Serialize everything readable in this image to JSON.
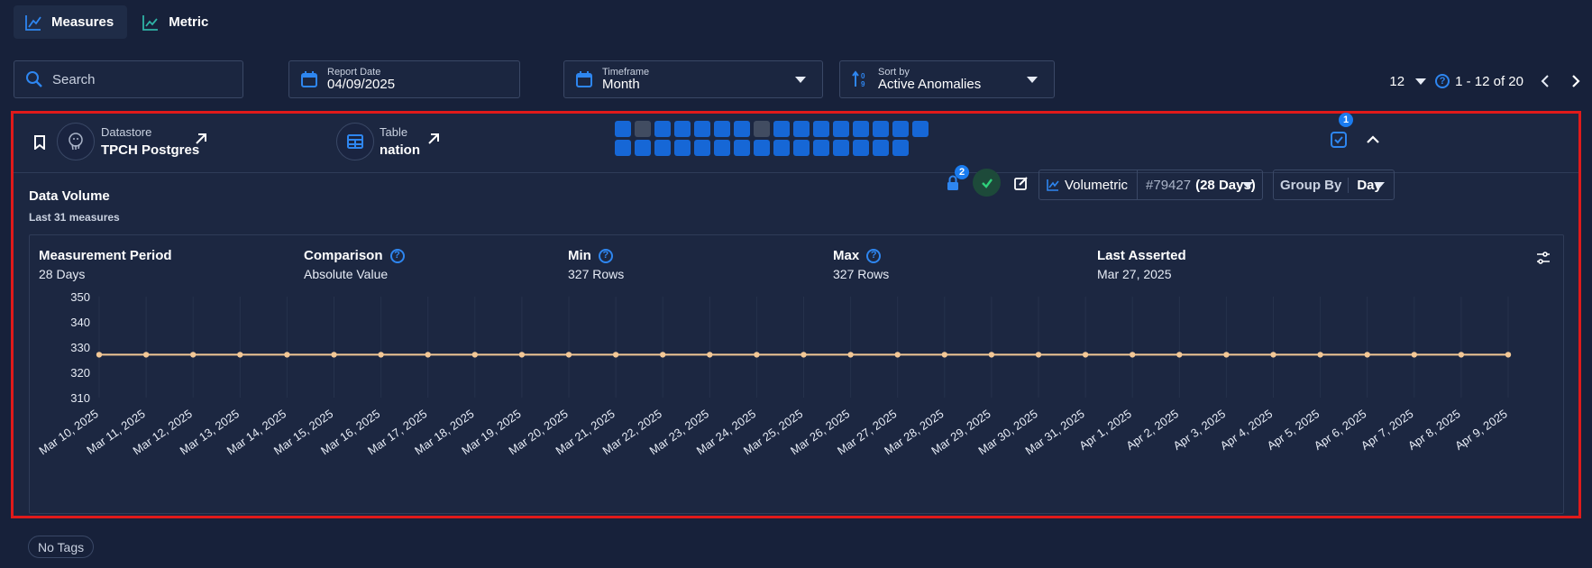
{
  "tabs": [
    {
      "label": "Measures",
      "active": true
    },
    {
      "label": "Metric",
      "active": false
    }
  ],
  "filters": {
    "search_placeholder": "Search",
    "report_date": {
      "label": "Report Date",
      "value": "04/09/2025"
    },
    "timeframe": {
      "label": "Timeframe",
      "value": "Month"
    },
    "sort_by": {
      "label": "Sort by",
      "value": "Active Anomalies"
    }
  },
  "pagination": {
    "per_page": "12",
    "range": "1 - 12 of 20"
  },
  "card": {
    "datastore_label": "Datastore",
    "datastore_value": "TPCH Postgres",
    "table_label": "Table",
    "table_value": "nation",
    "row1_squares": [
      "blue",
      "gray",
      "blue",
      "blue",
      "blue",
      "blue",
      "blue",
      "gray",
      "blue",
      "blue",
      "blue",
      "blue",
      "blue",
      "blue",
      "blue",
      "blue"
    ],
    "row2_squares": [
      "blue",
      "blue",
      "blue",
      "blue",
      "blue",
      "blue",
      "blue",
      "blue",
      "blue",
      "blue",
      "blue",
      "blue",
      "blue",
      "blue",
      "blue"
    ],
    "checks_badge": "1",
    "title": "Data Volume",
    "subtitle": "Last 31 measures",
    "anomaly_badge": "2",
    "volumetric_label": "Volumetric",
    "check_id": "#79427",
    "check_period": "(28 Days)",
    "group_by_label": "Group By",
    "group_by_value": "Day"
  },
  "stats": {
    "period": {
      "label": "Measurement Period",
      "value": "28 Days"
    },
    "comparison": {
      "label": "Comparison",
      "value": "Absolute Value"
    },
    "min": {
      "label": "Min",
      "value": "327 Rows"
    },
    "max": {
      "label": "Max",
      "value": "327 Rows"
    },
    "last_asserted": {
      "label": "Last Asserted",
      "value": "Mar 27, 2025"
    }
  },
  "chart_data": {
    "type": "line",
    "x": [
      "Mar 10, 2025",
      "Mar 11, 2025",
      "Mar 12, 2025",
      "Mar 13, 2025",
      "Mar 14, 2025",
      "Mar 15, 2025",
      "Mar 16, 2025",
      "Mar 17, 2025",
      "Mar 18, 2025",
      "Mar 19, 2025",
      "Mar 20, 2025",
      "Mar 21, 2025",
      "Mar 22, 2025",
      "Mar 23, 2025",
      "Mar 24, 2025",
      "Mar 25, 2025",
      "Mar 26, 2025",
      "Mar 27, 2025",
      "Mar 28, 2025",
      "Mar 29, 2025",
      "Mar 30, 2025",
      "Mar 31, 2025",
      "Apr 1, 2025",
      "Apr 2, 2025",
      "Apr 3, 2025",
      "Apr 4, 2025",
      "Apr 5, 2025",
      "Apr 6, 2025",
      "Apr 7, 2025",
      "Apr 8, 2025",
      "Apr 9, 2025"
    ],
    "series": [
      {
        "values": [
          327,
          327,
          327,
          327,
          327,
          327,
          327,
          327,
          327,
          327,
          327,
          327,
          327,
          327,
          327,
          327,
          327,
          327,
          327,
          327,
          327,
          327,
          327,
          327,
          327,
          327,
          327,
          327,
          327,
          327,
          327
        ]
      }
    ],
    "yticks": [
      "350",
      "340",
      "330",
      "320",
      "310"
    ],
    "ylim": [
      310,
      350
    ],
    "grid": true,
    "line_color": "#f3c896"
  },
  "tags_label": "No Tags",
  "colors": {
    "accent": "#1a7cf0",
    "highlight_border": "#e01a1a",
    "success": "#2fb36b"
  }
}
